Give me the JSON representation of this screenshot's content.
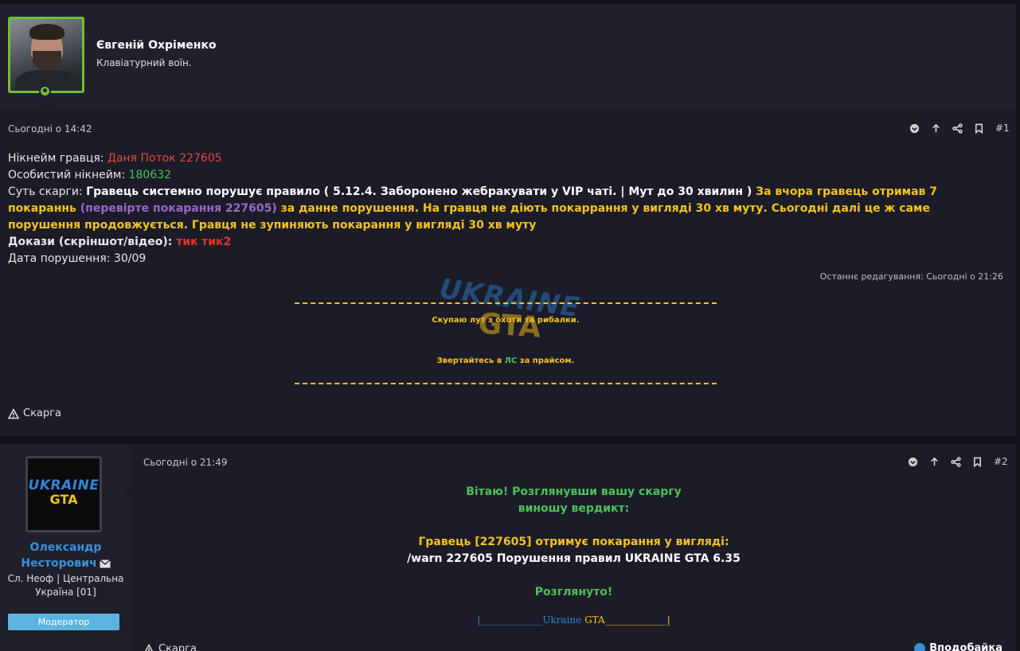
{
  "post1": {
    "author_name": "Євгеній Охріменко",
    "author_title": "Клавіатурний воїн.",
    "date": "Сьогодні о 14:42",
    "number": "#1",
    "lines": {
      "nick_label": "Нікнейм гравця: ",
      "nick_value": "Даня Поток 227605",
      "personal_label": "Особистий нікнейм: ",
      "personal_value": "180632",
      "essence_label": "Суть скарги: ",
      "essence_white": "Гравець системно порушує правило ( 5.12.4. Заборонено жебракувати у VIP чаті. | Мут до 30 хвилин ) ",
      "essence_yellow1": "За вчора гравець отримав 7 покараннь ",
      "essence_purple": "(перевірте покарання 227605)",
      "essence_yellow2": " за данне порушення. На гравця не діють покаррання у вигляді 30 хв муту. Сьогодні далі це ж саме порушення продовжується. Гравця не зупиняють покарання у вигляді 30 хв муту",
      "proof_label": "Докази (скріншот/відео): ",
      "proof_link1": "тик",
      "proof_link2": "тик2",
      "date_label": "Дата порушення: 30/09"
    },
    "last_edit": "Останнє редагування: Сьогодні о 21:26",
    "signature": {
      "line1": "Скупаю лут з охоти та рибалки.",
      "line2_a": "Звертайтесь в ",
      "line2_ls": "ЛС",
      "line2_b": " за прайсом.",
      "wm_top": "UKRAINE",
      "wm_bottom": "GTA"
    },
    "report_label": "Скарга"
  },
  "post2": {
    "author_name": "Олександр Несторович",
    "location": "Сл. Неоф | Центральна Україна [01]",
    "role": "Модератор",
    "avatar_top": "UKRAINE",
    "avatar_bottom": "GTA",
    "date": "Сьогодні о 21:49",
    "number": "#2",
    "lines": {
      "greet1": "Вітаю! Розглянувши вашу скаргу",
      "greet2": "виношу вердикт:",
      "verdict": "Гравець [227605] отримує покарання у вигляді:",
      "command": "/warn 227605 Порушення правил UKRAINE GTA 6.35",
      "reviewed": "Розглянуто!",
      "footer_a": "|_____________",
      "footer_ukraine": "Ukraine",
      "footer_gta": " GTA",
      "footer_b": "_____________|"
    },
    "report_label": "Скарга",
    "like_label": "Вподобайка"
  },
  "colors": {
    "accent_green": "#70c033",
    "link_blue": "#3b8fd9",
    "highlight_yellow": "#f5c31c",
    "badge_blue": "#5bb4df"
  },
  "icons": [
    "user-online-icon",
    "chevron-down-circle-icon",
    "arrow-up-icon",
    "share-icon",
    "bookmark-icon",
    "warning-icon",
    "envelope-icon",
    "like-icon"
  ]
}
